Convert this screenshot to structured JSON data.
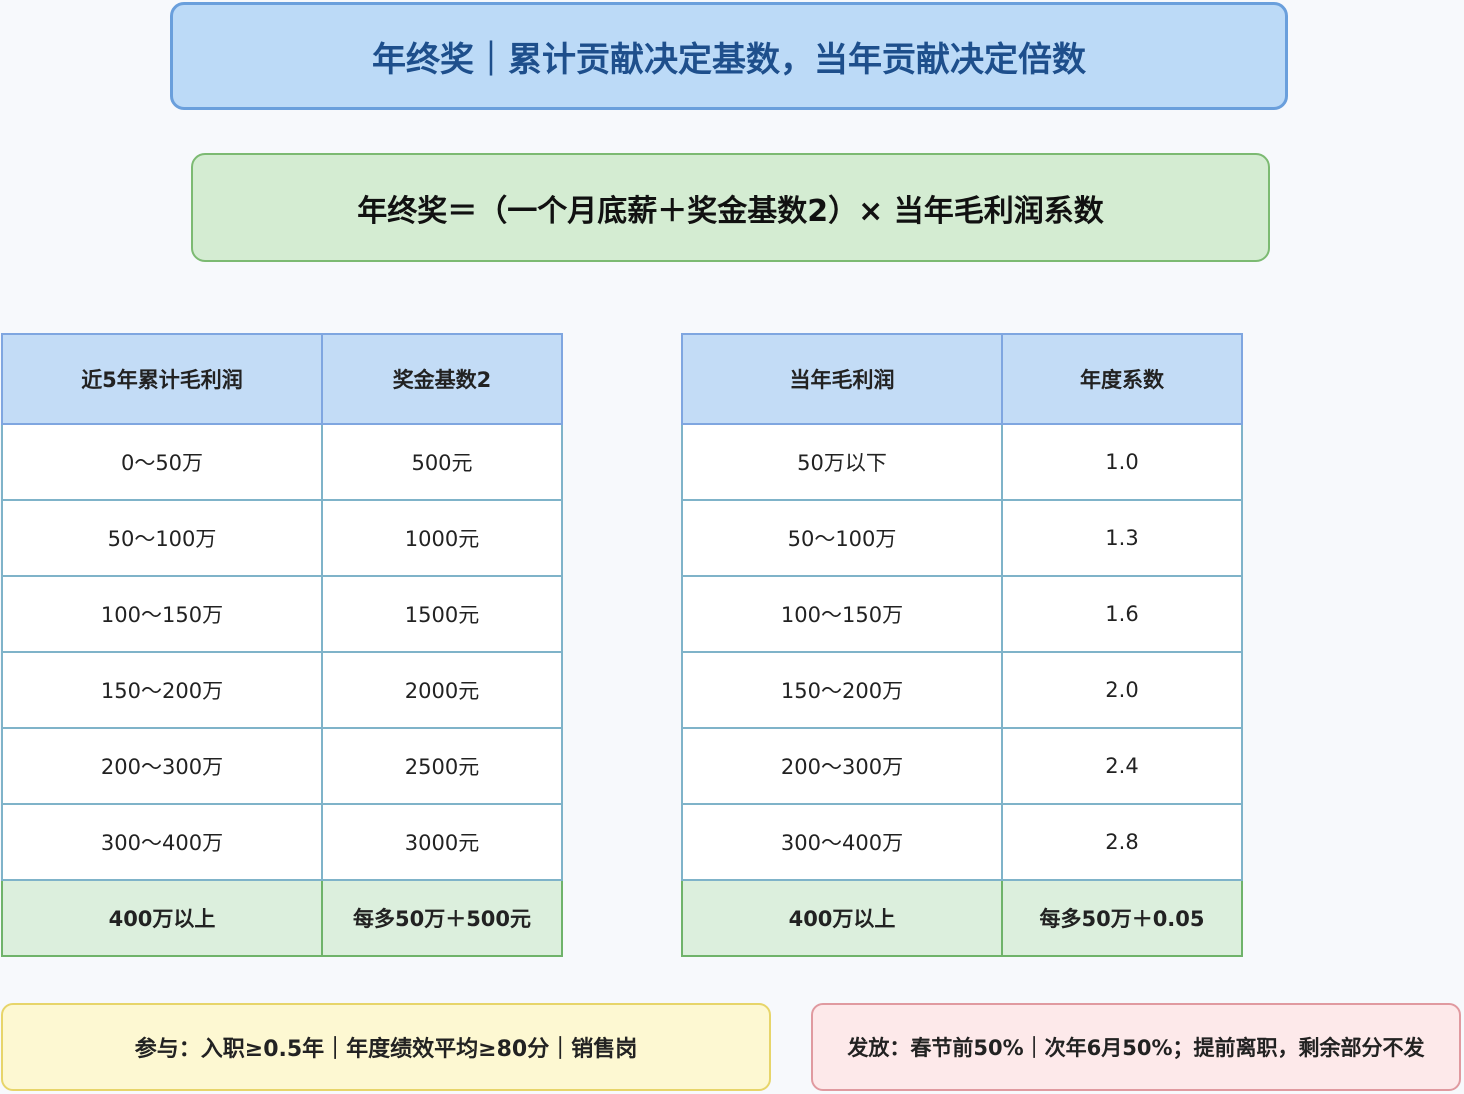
{
  "title": "年终奖｜累计贡献决定基数，当年贡献决定倍数",
  "formula": "年终奖＝（一个月底薪＋奖金基数2）× 当年毛利润系数",
  "left_table": {
    "headers": [
      "近5年累计毛利润",
      "奖金基数2"
    ],
    "rows": [
      [
        "0～50万",
        "500元"
      ],
      [
        "50～100万",
        "1000元"
      ],
      [
        "100～150万",
        "1500元"
      ],
      [
        "150～200万",
        "2000元"
      ],
      [
        "200～300万",
        "2500元"
      ],
      [
        "300～400万",
        "3000元"
      ],
      [
        "400万以上",
        "每多50万＋500元"
      ]
    ]
  },
  "right_table": {
    "headers": [
      "当年毛利润",
      "年度系数"
    ],
    "rows": [
      [
        "50万以下",
        "1.0"
      ],
      [
        "50～100万",
        "1.3"
      ],
      [
        "100～150万",
        "1.6"
      ],
      [
        "150～200万",
        "2.0"
      ],
      [
        "200～300万",
        "2.4"
      ],
      [
        "300～400万",
        "2.8"
      ],
      [
        "400万以上",
        "每多50万＋0.05"
      ]
    ]
  },
  "notes": {
    "participation": "参与：入职≥0.5年｜年度绩效平均≥80分｜销售岗",
    "payout": "发放：春节前50%｜次年6月50%；提前离职，剩余部分不发"
  },
  "colors": {
    "title_bg": "#bcdaf7",
    "title_text": "#1e4f8c",
    "formula_bg": "#d4ecd2",
    "header_bg": "#c3dcf6",
    "last_row_bg": "#dcefdd",
    "note_left_bg": "#fdf8d2",
    "note_right_bg": "#fde9ea"
  }
}
